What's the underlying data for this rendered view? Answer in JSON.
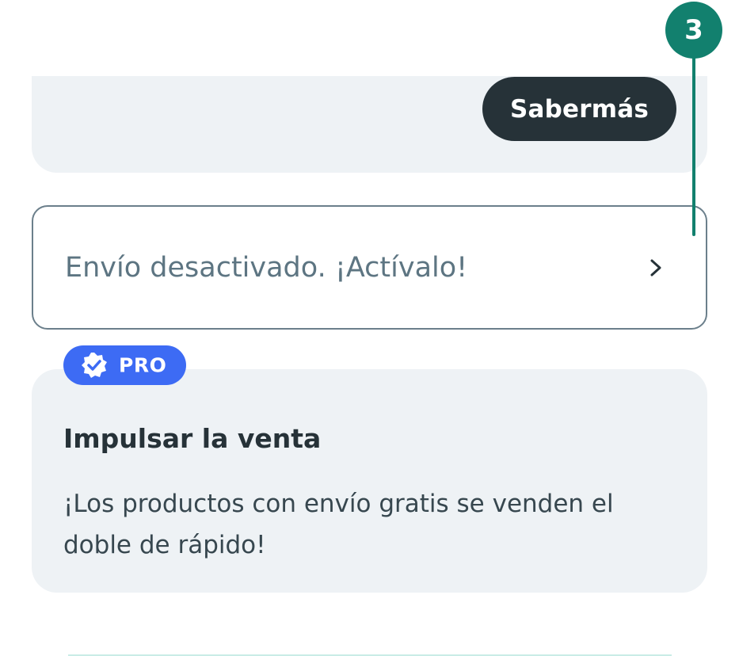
{
  "top_card": {
    "learn_more_label": "Sabermás"
  },
  "shipping": {
    "label": "Envío desactivado. ¡Actívalo!",
    "chevron_icon": "chevron-right-icon"
  },
  "pro_badge": {
    "label": "PRO",
    "icon": "verified-check-icon",
    "color": "#3d6bf4"
  },
  "boost_card": {
    "title": "Impulsar la venta",
    "description": "¡Los productos con envío gratis se venden el doble de rápido!"
  },
  "callout": {
    "number": "3",
    "color": "#12806e"
  }
}
